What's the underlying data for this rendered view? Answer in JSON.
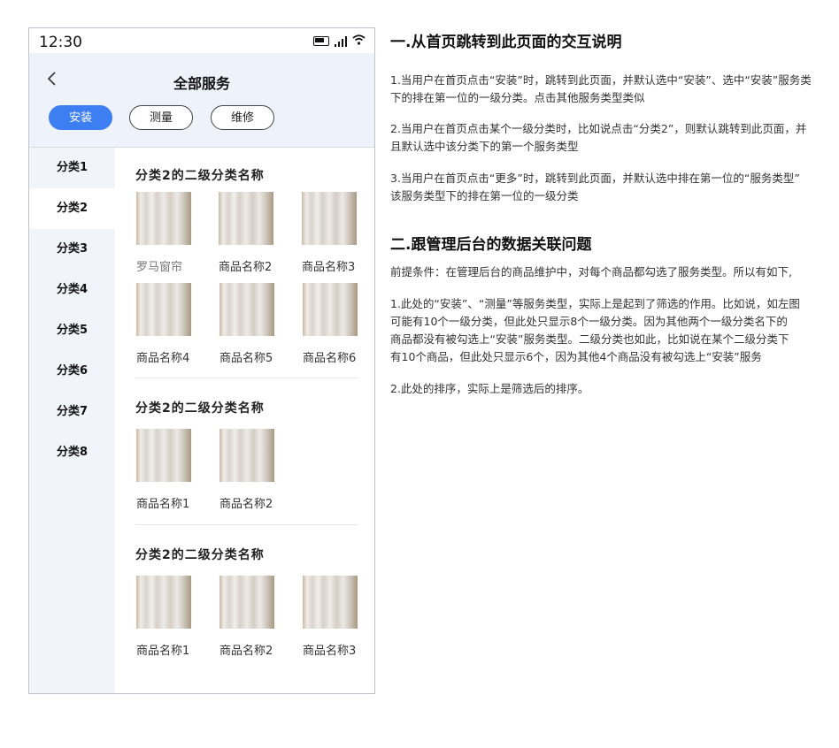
{
  "status_bar": {
    "time": "12:30"
  },
  "header": {
    "title": "全部服务",
    "tabs": [
      {
        "label": "安装"
      },
      {
        "label": "测量"
      },
      {
        "label": "维修"
      }
    ]
  },
  "sidebar": {
    "items": [
      "分类1",
      "分类2",
      "分类3",
      "分类4",
      "分类5",
      "分类6",
      "分类7",
      "分类8"
    ]
  },
  "sections": [
    {
      "title": "分类2的二级分类名称",
      "products": [
        "罗马窗帘",
        "商品名称2",
        "商品名称3",
        "商品名称4",
        "商品名称5",
        "商品名称6"
      ]
    },
    {
      "title": "分类2的二级分类名称",
      "products": [
        "商品名称1",
        "商品名称2"
      ]
    },
    {
      "title": "分类2的二级分类名称",
      "products": [
        "商品名称1",
        "商品名称2",
        "商品名称3"
      ]
    }
  ],
  "notes": {
    "h1": "一.从首页跳转到此页面的交互说明",
    "p1a": "1.当用户在首页点击“安装”时，跳转到此页面，并默认选中“安装”、选中“安装”服务类",
    "p1b": "下的排在第一位的一级分类。点击其他服务类型类似",
    "p2a": "2.当用户在首页点击某个一级分类时，比如说点击“分类2”，则默认跳转到此页面，并",
    "p2b": "  且默认选中该分类下的第一个服务类型",
    "p3a": "3.当用户在首页点击“更多”时，跳转到此页面，并默认选中排在第一位的“服务类型”",
    "p3b": "   该服务类型下的排在第一位的一级分类",
    "h2": "二.跟管理后台的数据关联问题",
    "pre": "前提条件：在管理后台的商品维护中，对每个商品都勾选了服务类型。所以有如下,",
    "q1a": "1.此处的“安装”、“测量”等服务类型，实际上是起到了筛选的作用。比如说，如左图",
    "q1b": "   可能有10个一级分类，但此处只显示8个一级分类。因为其他两个一级分类名下的",
    "q1c": "   商品都没有被勾选上“安装”服务类型。二级分类也如此，比如说在某个二级分类下",
    "q1d": "   有10个商品，但此处只显示6个，因为其他4个商品没有被勾选上“安装”服务",
    "q2": "2.此处的排序，实际上是筛选后的排序。"
  }
}
